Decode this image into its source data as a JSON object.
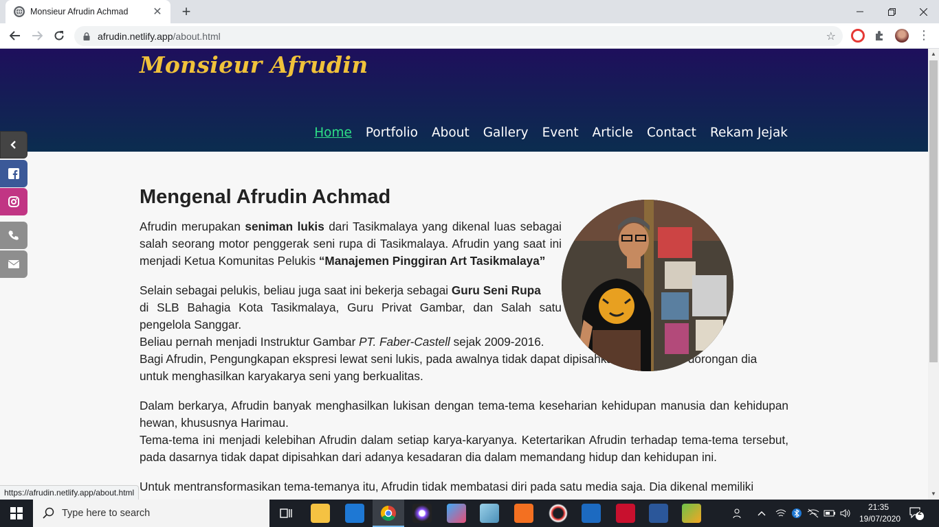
{
  "browser": {
    "tab_title": "Monsieur Afrudin Achmad",
    "url_domain": "afrudin.netlify.app",
    "url_path": "/about.html",
    "status_url": "https://afrudin.netlify.app/about.html"
  },
  "site": {
    "brand": "Monsieur Afrudin",
    "nav": [
      "Home",
      "Portfolio",
      "About",
      "Gallery",
      "Event",
      "Article",
      "Contact",
      "Rekam Jejak"
    ],
    "active_nav": "Home"
  },
  "article": {
    "heading": "Mengenal Afrudin Achmad",
    "p1_a": "Afrudin merupakan ",
    "p1_b": "seniman lukis",
    "p1_c": " dari Tasikmalaya yang dikenal luas sebagai salah seorang motor penggerak seni rupa di Tasikmalaya. Afrudin yang saat ini menjadi Ketua Komunitas Pelukis ",
    "p1_d": "“Manajemen Pinggiran Art Tasikmalaya”",
    "p2_a": "Selain sebagai pelukis, beliau juga saat ini bekerja sebagai ",
    "p2_b": "Guru Seni Rupa",
    "p2_c": "di SLB Bahagia Kota Tasikmalaya, Guru Privat Gambar, dan Salah satu pengelola Sanggar.",
    "p2_d": "Beliau pernah menjadi Instruktur Gambar ",
    "p2_e": "PT. Faber-Castell",
    "p2_f": " sejak 2009-2016.",
    "p2_g": "Bagi Afrudin, Pengungkapan ekspresi lewat seni lukis, pada awalnya tidak dapat dipisahkan dari adanya dorongan dia untuk menghasilkan karyakarya seni yang berkualitas.",
    "p3_a": "Dalam berkarya, Afrudin banyak menghasilkan lukisan dengan tema-tema keseharian kehidupan manusia dan kehidupan hewan, khususnya Harimau.",
    "p3_b": "Tema-tema ini menjadi kelebihan Afrudin dalam setiap karya-karyanya. Ketertarikan Afrudin terhadap tema-tema tersebut, pada dasarnya tidak dapat dipisahkan dari adanya kesadaran dia dalam memandang hidup dan kehidupan ini.",
    "p4": "Untuk mentransformasikan tema-temanya itu, Afrudin tidak membatasi diri pada satu media saja. Dia dikenal memiliki"
  },
  "taskbar": {
    "search_placeholder": "Type here to search",
    "time": "21:35",
    "date": "19/07/2020",
    "notifications": "2"
  },
  "colors": {
    "header_top": "#1e0f5c",
    "header_bottom": "#0b2d4f",
    "brand": "#f0c23a",
    "nav_active": "#2ee087",
    "facebook": "#3b5998",
    "instagram": "#c13584",
    "phone": "#8e8e8e",
    "email": "#8e8e8e"
  }
}
